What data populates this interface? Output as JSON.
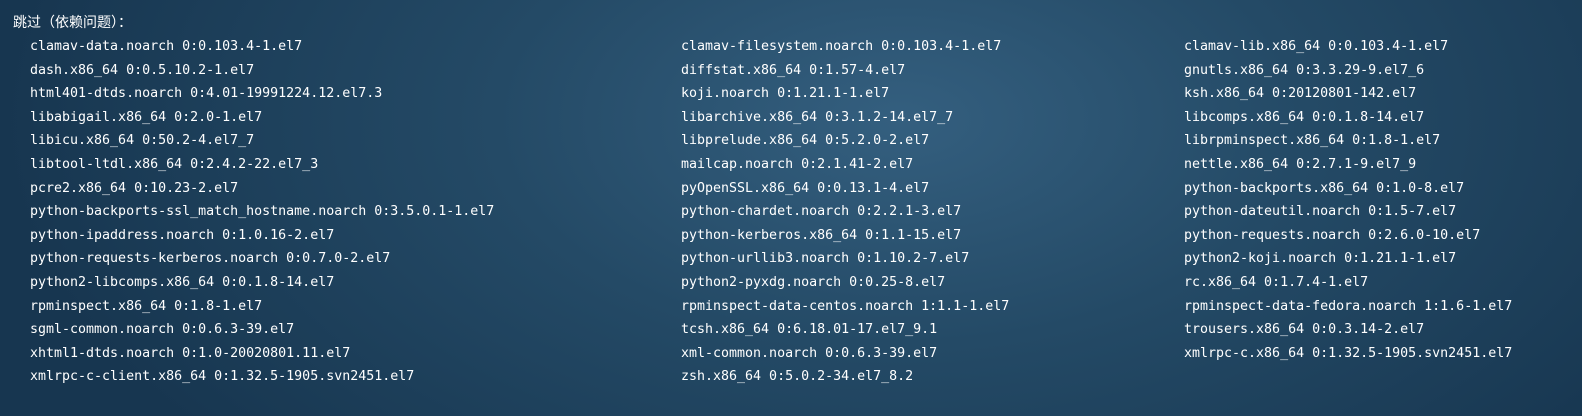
{
  "header": {
    "title": "跳过（依赖问题）："
  },
  "packages": {
    "column1": [
      "clamav-data.noarch 0:0.103.4-1.el7",
      "dash.x86_64 0:0.5.10.2-1.el7",
      "html401-dtds.noarch 0:4.01-19991224.12.el7.3",
      "libabigail.x86_64 0:2.0-1.el7",
      "libicu.x86_64 0:50.2-4.el7_7",
      "libtool-ltdl.x86_64 0:2.4.2-22.el7_3",
      "pcre2.x86_64 0:10.23-2.el7",
      "python-backports-ssl_match_hostname.noarch 0:3.5.0.1-1.el7",
      "python-ipaddress.noarch 0:1.0.16-2.el7",
      "python-requests-kerberos.noarch 0:0.7.0-2.el7",
      "python2-libcomps.x86_64 0:0.1.8-14.el7",
      "rpminspect.x86_64 0:1.8-1.el7",
      "sgml-common.noarch 0:0.6.3-39.el7",
      "xhtml1-dtds.noarch 0:1.0-20020801.11.el7",
      "xmlrpc-c-client.x86_64 0:1.32.5-1905.svn2451.el7"
    ],
    "column2": [
      "clamav-filesystem.noarch 0:0.103.4-1.el7",
      "diffstat.x86_64 0:1.57-4.el7",
      "koji.noarch 0:1.21.1-1.el7",
      "libarchive.x86_64 0:3.1.2-14.el7_7",
      "libprelude.x86_64 0:5.2.0-2.el7",
      "mailcap.noarch 0:2.1.41-2.el7",
      "pyOpenSSL.x86_64 0:0.13.1-4.el7",
      "python-chardet.noarch 0:2.2.1-3.el7",
      "python-kerberos.x86_64 0:1.1-15.el7",
      "python-urllib3.noarch 0:1.10.2-7.el7",
      "python2-pyxdg.noarch 0:0.25-8.el7",
      "rpminspect-data-centos.noarch 1:1.1-1.el7",
      "tcsh.x86_64 0:6.18.01-17.el7_9.1",
      "xml-common.noarch 0:0.6.3-39.el7",
      "zsh.x86_64 0:5.0.2-34.el7_8.2"
    ],
    "column3": [
      "clamav-lib.x86_64 0:0.103.4-1.el7",
      "gnutls.x86_64 0:3.3.29-9.el7_6",
      "ksh.x86_64 0:20120801-142.el7",
      "libcomps.x86_64 0:0.1.8-14.el7",
      "librpminspect.x86_64 0:1.8-1.el7",
      "nettle.x86_64 0:2.7.1-9.el7_9",
      "python-backports.x86_64 0:1.0-8.el7",
      "python-dateutil.noarch 0:1.5-7.el7",
      "python-requests.noarch 0:2.6.0-10.el7",
      "python2-koji.noarch 0:1.21.1-1.el7",
      "rc.x86_64 0:1.7.4-1.el7",
      "rpminspect-data-fedora.noarch 1:1.6-1.el7",
      "trousers.x86_64 0:0.3.14-2.el7",
      "xmlrpc-c.x86_64 0:1.32.5-1905.svn2451.el7"
    ]
  },
  "colors": {
    "background_center": "#345f7f",
    "background_edge": "#173650",
    "text": "#ffffff"
  }
}
